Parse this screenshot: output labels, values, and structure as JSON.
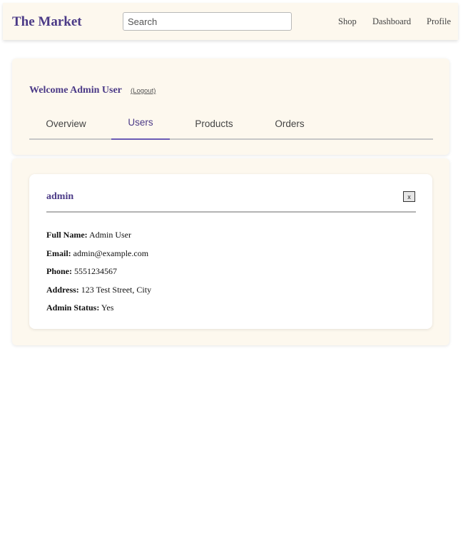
{
  "header": {
    "brand": "The Market",
    "search_placeholder": "Search",
    "nav": {
      "shop": "Shop",
      "dashboard": "Dashboard",
      "profile": "Profile"
    }
  },
  "dashboard": {
    "welcome": "Welcome Admin User",
    "logout": "(Logout)",
    "tabs": [
      {
        "label": "Overview",
        "active": false
      },
      {
        "label": "Users",
        "active": true
      },
      {
        "label": "Products",
        "active": false
      },
      {
        "label": "Orders",
        "active": false
      }
    ]
  },
  "user_card": {
    "username": "admin",
    "close_label": "x",
    "fields": [
      {
        "label": "Full Name:",
        "value": "Admin User"
      },
      {
        "label": "Email:",
        "value": "admin@example.com"
      },
      {
        "label": "Phone:",
        "value": "5551234567"
      },
      {
        "label": "Address:",
        "value": "123 Test Street, City"
      },
      {
        "label": "Admin Status:",
        "value": "Yes"
      }
    ]
  },
  "colors": {
    "brand": "#4b3a87",
    "panel_bg": "#fdf8ee",
    "active_tab_underline": "#6b5bb5"
  }
}
